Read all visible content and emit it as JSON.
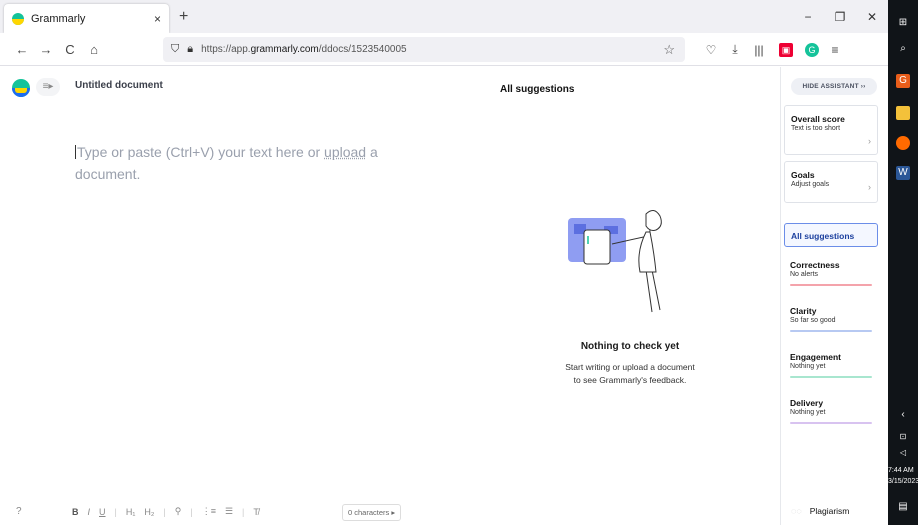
{
  "browser": {
    "tab_title": "Grammarly",
    "tab_close": "×",
    "new_tab": "+",
    "url_prefix": "https://app.",
    "url_host": "grammarly.com",
    "url_path": "/ddocs/1523540005",
    "window_controls": {
      "minimize": "−",
      "restore": "❐",
      "close": "✕"
    },
    "nav": {
      "back": "←",
      "forward": "→",
      "reload": "C",
      "home": "⌂"
    },
    "star": "☆",
    "toolbar_icons": {
      "pocket": "♡",
      "download": "⤓",
      "library": "|||",
      "ext_red": "▣",
      "ext_grammarly": "G",
      "menu": "≡"
    }
  },
  "editor": {
    "doc_title": "Untitled document",
    "placeholder_1": "Type or paste (Ctrl+V) your text here or ",
    "placeholder_link": "upload",
    "placeholder_2": " a document.",
    "char_count": "0 characters ▸"
  },
  "format_bar": {
    "help": "?",
    "bold": "B",
    "italic": "I",
    "underline": "U",
    "h1": "H₁",
    "h2": "H₂",
    "link": "⚲",
    "ol": "⋮≡",
    "ul": "☰",
    "clear": "T̸",
    "sep": "|"
  },
  "suggestions": {
    "header": "All suggestions",
    "empty_title": "Nothing to check yet",
    "empty_desc_1": "Start writing or upload a document",
    "empty_desc_2": "to see Grammarly's feedback."
  },
  "assistant": {
    "hide_label": "HIDE ASSISTANT  ››",
    "overall": {
      "title": "Overall score",
      "sub": "Text is too short",
      "chev": "›"
    },
    "goals": {
      "title": "Goals",
      "sub": "Adjust goals",
      "chev": "›"
    },
    "all_suggestions": "All suggestions",
    "categories": [
      {
        "title": "Correctness",
        "sub": "No alerts",
        "color": "#f4a3ab"
      },
      {
        "title": "Clarity",
        "sub": "So far so good",
        "color": "#b7c9f2"
      },
      {
        "title": "Engagement",
        "sub": "Nothing yet",
        "color": "#a8e6cf"
      },
      {
        "title": "Delivery",
        "sub": "Nothing yet",
        "color": "#d8c3f0"
      }
    ],
    "plagiarism": "Plagiarism"
  },
  "taskbar": {
    "time": "7:44 AM",
    "date": "3/15/2023"
  },
  "colors": {
    "accent": "#15c39a",
    "selected_border": "#6b8de8",
    "illustration_blue": "#7b8cf0"
  },
  "icons": [
    "windows-icon",
    "search-icon",
    "brand-icon",
    "file-explorer-icon",
    "firefox-icon",
    "word-icon",
    "chevron-left-icon",
    "notification-icon"
  ]
}
